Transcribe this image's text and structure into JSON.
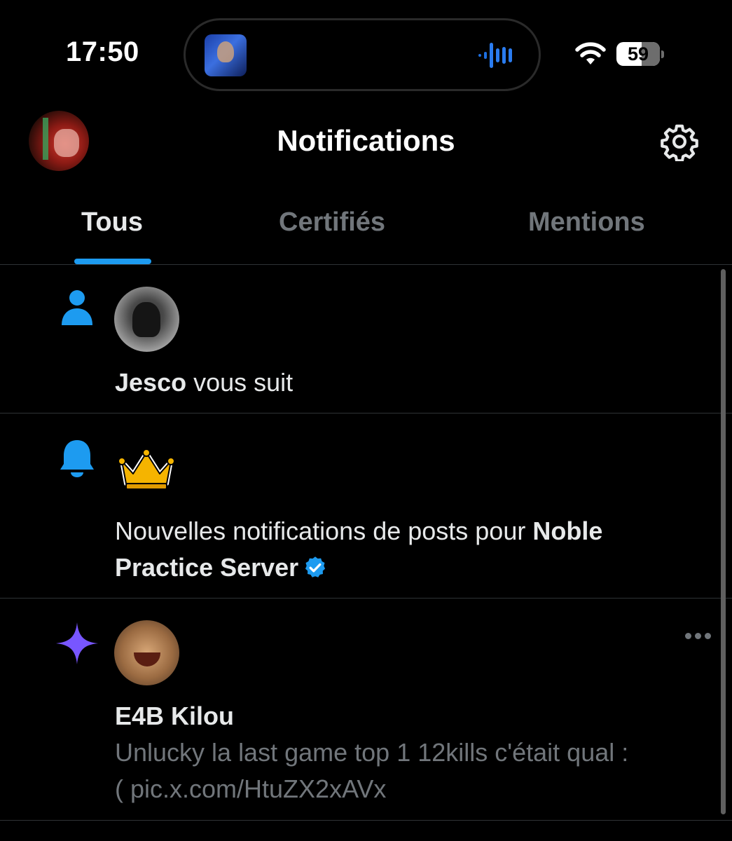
{
  "status_bar": {
    "time": "17:50",
    "battery": "59",
    "wifi_icon": "wifi-icon",
    "now_playing_icon": "audio-waveform-icon"
  },
  "header": {
    "title": "Notifications",
    "settings_icon": "gear-icon"
  },
  "tabs": [
    {
      "label": "Tous",
      "active": true
    },
    {
      "label": "Certifiés",
      "active": false
    },
    {
      "label": "Mentions",
      "active": false
    }
  ],
  "notifications": [
    {
      "type_icon": "person-icon",
      "name": "Jesco",
      "text": " vous suit"
    },
    {
      "type_icon": "bell-icon",
      "avatar_icon": "crown-emoji-icon",
      "text": "Nouvelles notifications de posts pour ",
      "name_line1": "Noble",
      "name_line2": "Practice Server",
      "verified": true
    },
    {
      "type_icon": "sparkle-icon",
      "name": "E4B Kilou",
      "post_line1": "Unlucky la last game top 1 12kills c'était qual :",
      "post_line2": "( pic.x.com/HtuZX2xAVx",
      "more_icon": "more-dots-icon"
    }
  ],
  "colors": {
    "accent": "#1d9bf0",
    "sparkle": "#7856ff",
    "muted": "#71767b",
    "crown": "#f5b400"
  }
}
